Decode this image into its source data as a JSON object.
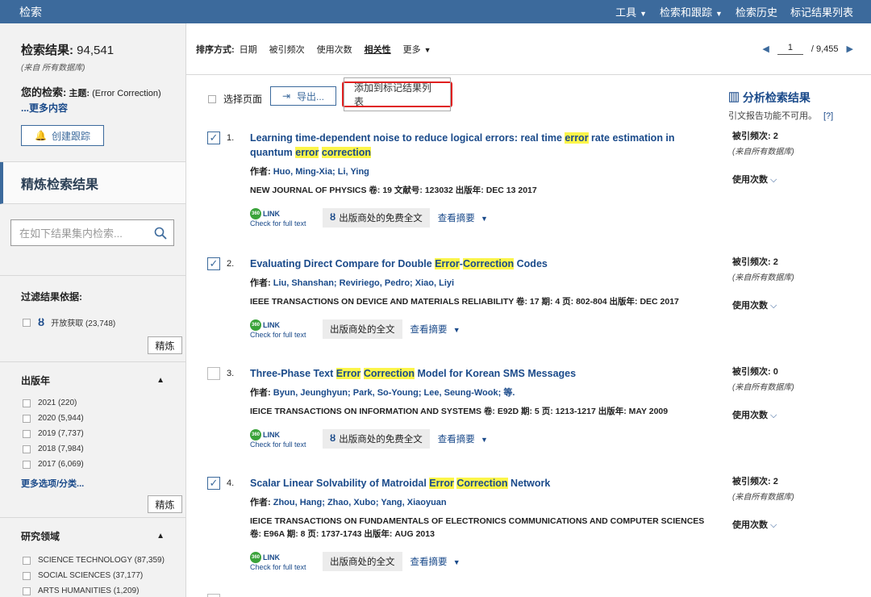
{
  "topbar": {
    "brand": "检索",
    "nav": [
      "工具",
      "检索和跟踪",
      "检索历史",
      "标记结果列表"
    ]
  },
  "summary": {
    "label": "检索结果:",
    "count": "94,541",
    "source_note": "(来自 所有数据库)",
    "query_label": "您的检索:",
    "query_field": "主题:",
    "query_text": "(Error Correction)",
    "more": "...更多内容",
    "track_button": "创建跟踪"
  },
  "refine": {
    "title": "精炼检索结果",
    "search_placeholder": "在如下结果集内检索...",
    "refine_label": "精炼"
  },
  "filters": {
    "by_label": "过滤结果依据:",
    "open_access": "开放获取 (23,748)",
    "year": {
      "title": "出版年",
      "items": [
        "2021 (220)",
        "2020 (5,944)",
        "2019 (7,737)",
        "2018 (7,984)",
        "2017 (6,069)"
      ],
      "more": "更多选项/分类..."
    },
    "field": {
      "title": "研究领域",
      "items": [
        "SCIENCE TECHNOLOGY (87,359)",
        "SOCIAL SCIENCES (37,177)",
        "ARTS HUMANITIES (1,209)"
      ]
    }
  },
  "sort": {
    "label": "排序方式:",
    "options": [
      "日期",
      "被引频次",
      "使用次数",
      "相关性",
      "更多"
    ]
  },
  "pager": {
    "page": "1",
    "total": "/ 9,455"
  },
  "toolbar": {
    "select_page": "选择页面",
    "export": "导出...",
    "add_marked": "添加到标记结果列表"
  },
  "analyze": {
    "title": "分析检索结果",
    "note": "引文报告功能不可用。",
    "help": "[?]"
  },
  "labels": {
    "authors": "作者:",
    "cited": "被引频次:",
    "source_note": "(来自所有数据库)",
    "usage": "使用次数",
    "link": "LINK",
    "link_sub": "Check for full text",
    "abstract": "查看摘要",
    "ft_free": "出版商处的免费全文",
    "ft": "出版商处的全文"
  },
  "records": [
    {
      "num": "1.",
      "checked": true,
      "title": [
        [
          "Learning time-dependent noise to reduce logical errors: real time ",
          false
        ],
        [
          "error",
          true
        ],
        [
          " rate estimation in quantum ",
          false
        ],
        [
          "error",
          true
        ],
        [
          " ",
          false
        ],
        [
          "correction",
          true
        ]
      ],
      "authors": "Huo, Ming-Xia; Li, Ying",
      "source": "NEW JOURNAL OF PHYSICS  卷: 19    文献号: 123032  出版年: DEC 13 2017",
      "cited": "2",
      "free": true
    },
    {
      "num": "2.",
      "checked": true,
      "title": [
        [
          "Evaluating Direct Compare for Double ",
          false
        ],
        [
          "Error",
          true
        ],
        [
          "-",
          false
        ],
        [
          "Correction",
          true
        ],
        [
          " Codes",
          false
        ]
      ],
      "authors": "Liu, Shanshan; Reviriego, Pedro; Xiao, Liyi",
      "source": "IEEE TRANSACTIONS ON DEVICE AND MATERIALS RELIABILITY  卷: 17   期: 4   页: 802-804   出版年: DEC 2017",
      "cited": "2",
      "free": false
    },
    {
      "num": "3.",
      "checked": false,
      "title": [
        [
          "Three-Phase Text ",
          false
        ],
        [
          "Error",
          true
        ],
        [
          " ",
          false
        ],
        [
          "Correction",
          true
        ],
        [
          " Model for Korean SMS Messages",
          false
        ]
      ],
      "authors": "Byun, Jeunghyun; Park, So-Young; Lee, Seung-Wook; 等.",
      "source": "IEICE TRANSACTIONS ON INFORMATION AND SYSTEMS  卷: E92D   期: 5   页: 1213-1217   出版年: MAY 2009",
      "cited": "0",
      "free": true
    },
    {
      "num": "4.",
      "checked": true,
      "title": [
        [
          "Scalar Linear Solvability of Matroidal ",
          false
        ],
        [
          "Error",
          true
        ],
        [
          " ",
          false
        ],
        [
          "Correction",
          true
        ],
        [
          " Network",
          false
        ]
      ],
      "authors": "Zhou, Hang; Zhao, Xubo; Yang, Xiaoyuan",
      "source": "IEICE TRANSACTIONS ON FUNDAMENTALS OF ELECTRONICS COMMUNICATIONS AND COMPUTER SCIENCES  卷: E96A   期: 8   页: 1737-1743   出版年: AUG 2013",
      "cited": "2",
      "free": false
    }
  ]
}
